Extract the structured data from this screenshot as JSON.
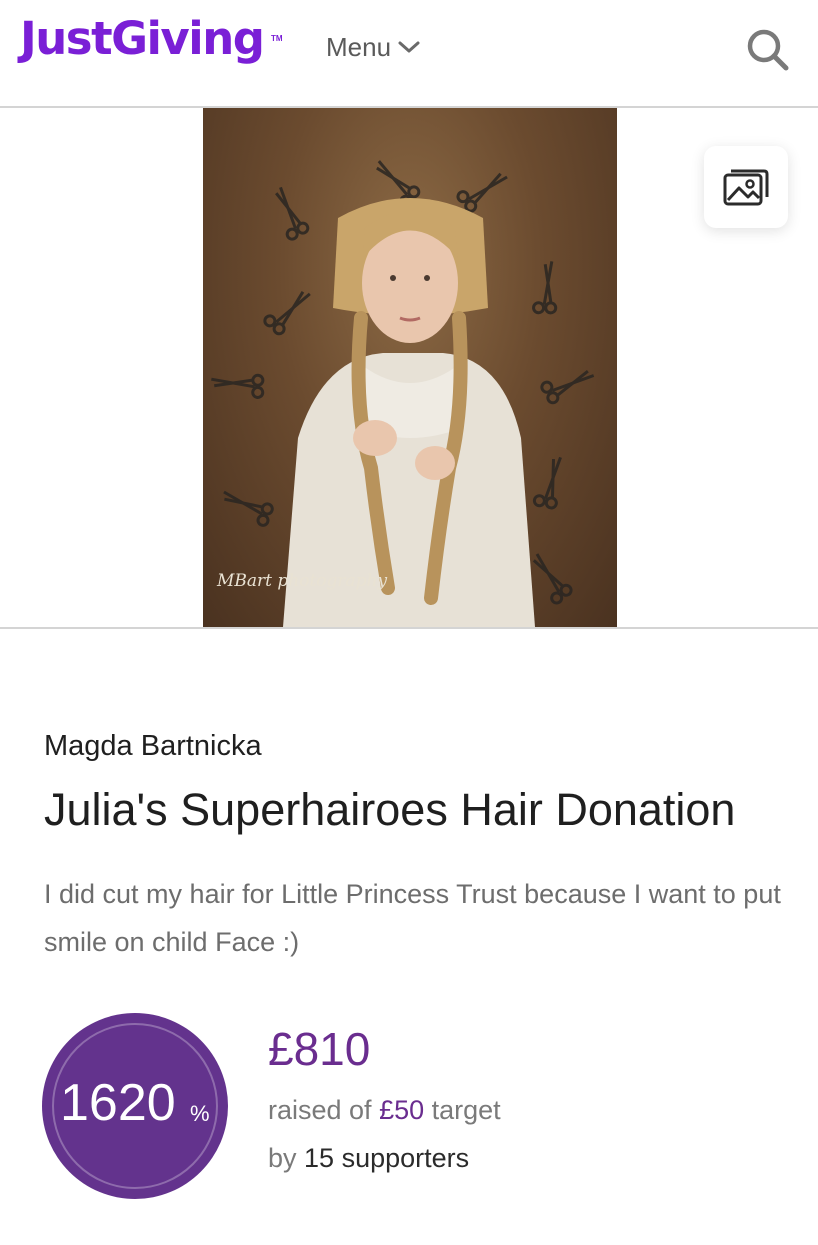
{
  "header": {
    "logo": "JustGiving",
    "trademark": "TM",
    "menu_label": "Menu"
  },
  "hero": {
    "photo_watermark": "MBart photography"
  },
  "page": {
    "fundraiser_name": "Magda Bartnicka",
    "title": "Julia's Superhairoes Hair Donation",
    "story": "I did cut my hair for Little Princess Trust because I want to put smile on child Face :)"
  },
  "progress": {
    "percent": "1620",
    "percent_sign": "%",
    "raised_amount": "£810",
    "raised_prefix": "raised of ",
    "target_amount": "£50",
    "target_suffix": " target",
    "by_prefix": "by ",
    "supporters": "15 supporters"
  },
  "colors": {
    "brand_purple": "#7a1fd6",
    "progress_purple": "#63338d",
    "amount_purple": "#6a2d8f"
  },
  "icons": [
    "chevron-down-icon",
    "search-icon",
    "gallery-icon"
  ]
}
